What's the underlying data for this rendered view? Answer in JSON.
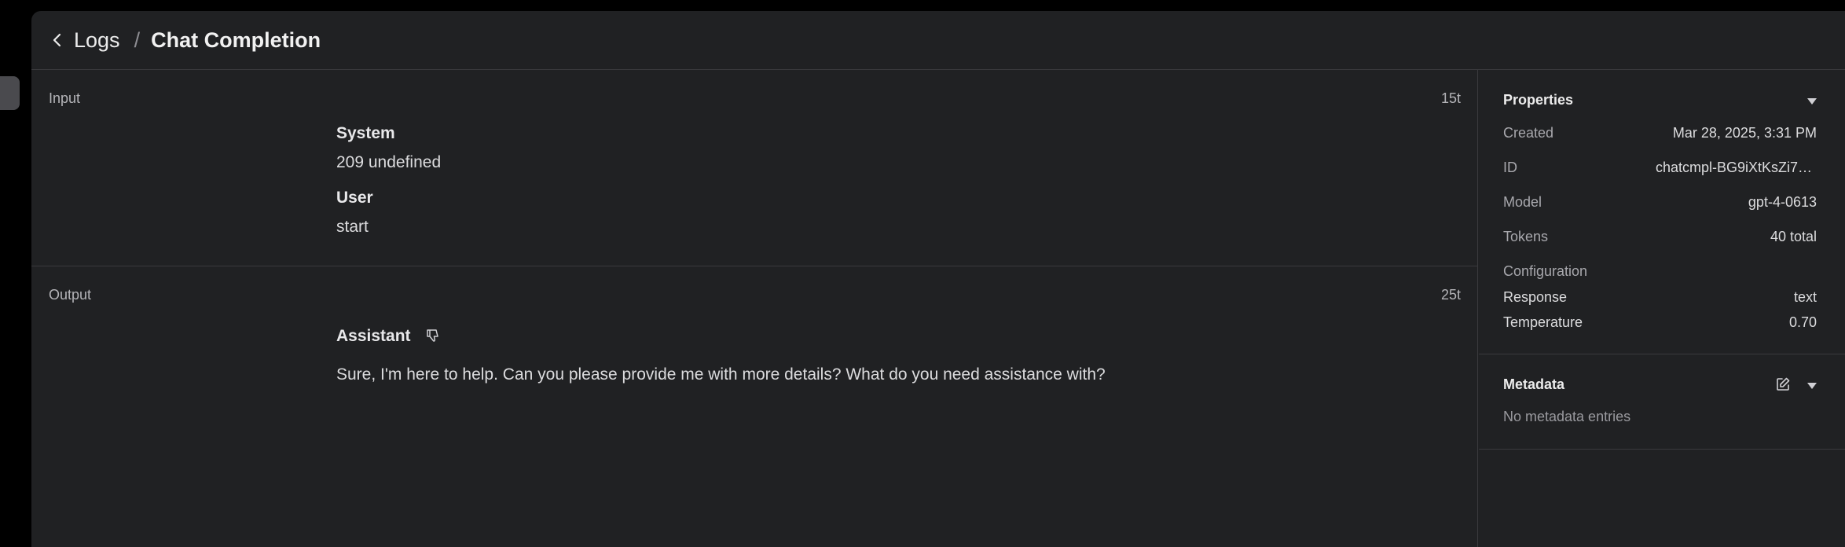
{
  "breadcrumb": {
    "parent": "Logs",
    "separator": "/",
    "current": "Chat Completion"
  },
  "input": {
    "label": "Input",
    "tokens": "15t",
    "messages": [
      {
        "role": "System",
        "content": "209 undefined"
      },
      {
        "role": "User",
        "content": "start"
      }
    ]
  },
  "output": {
    "label": "Output",
    "tokens": "25t",
    "message": {
      "role": "Assistant",
      "content": "Sure, I'm here to help. Can you please provide me with more details? What do you need assistance with?"
    }
  },
  "properties": {
    "title": "Properties",
    "created_label": "Created",
    "created_value": "Mar 28, 2025, 3:31 PM",
    "id_label": "ID",
    "id_value": "chatcmpl-BG9iXtKsZi7…",
    "model_label": "Model",
    "model_value": "gpt-4-0613",
    "tokens_label": "Tokens",
    "tokens_value": "40 total",
    "configuration_label": "Configuration",
    "response_label": "Response",
    "response_value": "text",
    "temperature_label": "Temperature",
    "temperature_value": "0.70"
  },
  "metadata": {
    "title": "Metadata",
    "empty_text": "No metadata entries"
  },
  "icons": {
    "back": "chevron-left-icon",
    "thumb": "thumbs-down-icon",
    "edit": "edit-icon",
    "caret": "caret-down-icon"
  },
  "colors": {
    "panel": "#202123",
    "border": "#3a3a3d",
    "background": "#000000"
  }
}
